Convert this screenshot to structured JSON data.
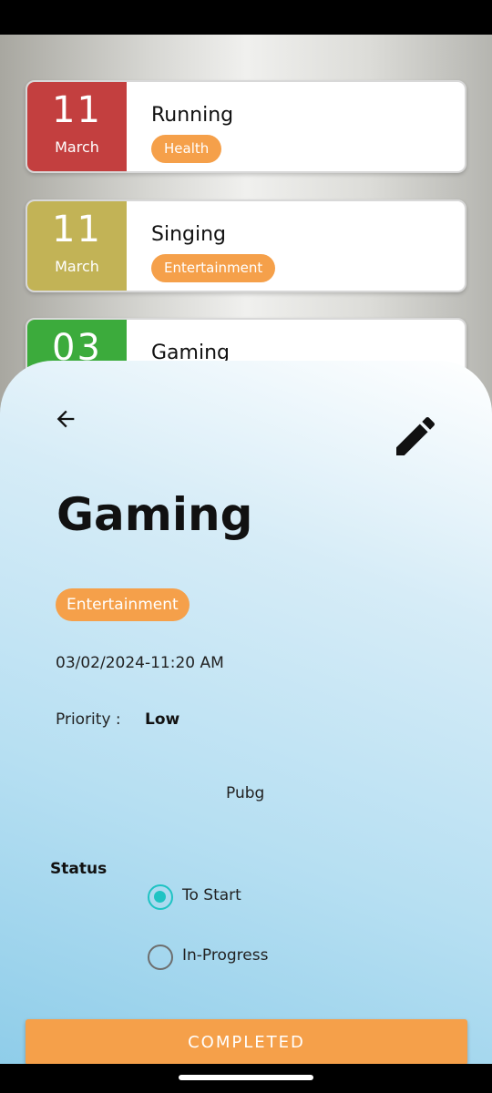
{
  "tasks": [
    {
      "day": "11",
      "month": "March",
      "title": "Running",
      "tag": "Health",
      "color": "#c33f3f"
    },
    {
      "day": "11",
      "month": "March",
      "title": "Singing",
      "tag": "Entertainment",
      "color": "#c2b356"
    },
    {
      "day": "03",
      "month": "",
      "title": "Gaming",
      "tag": "",
      "color": "#3cab3c"
    }
  ],
  "detail": {
    "title": "Gaming",
    "tag": "Entertainment",
    "datetime": "03/02/2024-11:20 AM",
    "priority_label": "Priority :",
    "priority_value": "Low",
    "description": "Pubg",
    "status_label": "Status",
    "status_options": [
      {
        "label": "To Start",
        "checked": true
      },
      {
        "label": "In-Progress",
        "checked": false
      }
    ],
    "complete_button": "COMPLETED"
  },
  "icons": {
    "back": "arrow-left-icon",
    "edit": "pencil-icon"
  },
  "colors": {
    "accent": "#f5a04a",
    "radio_checked": "#1ec3c3"
  }
}
